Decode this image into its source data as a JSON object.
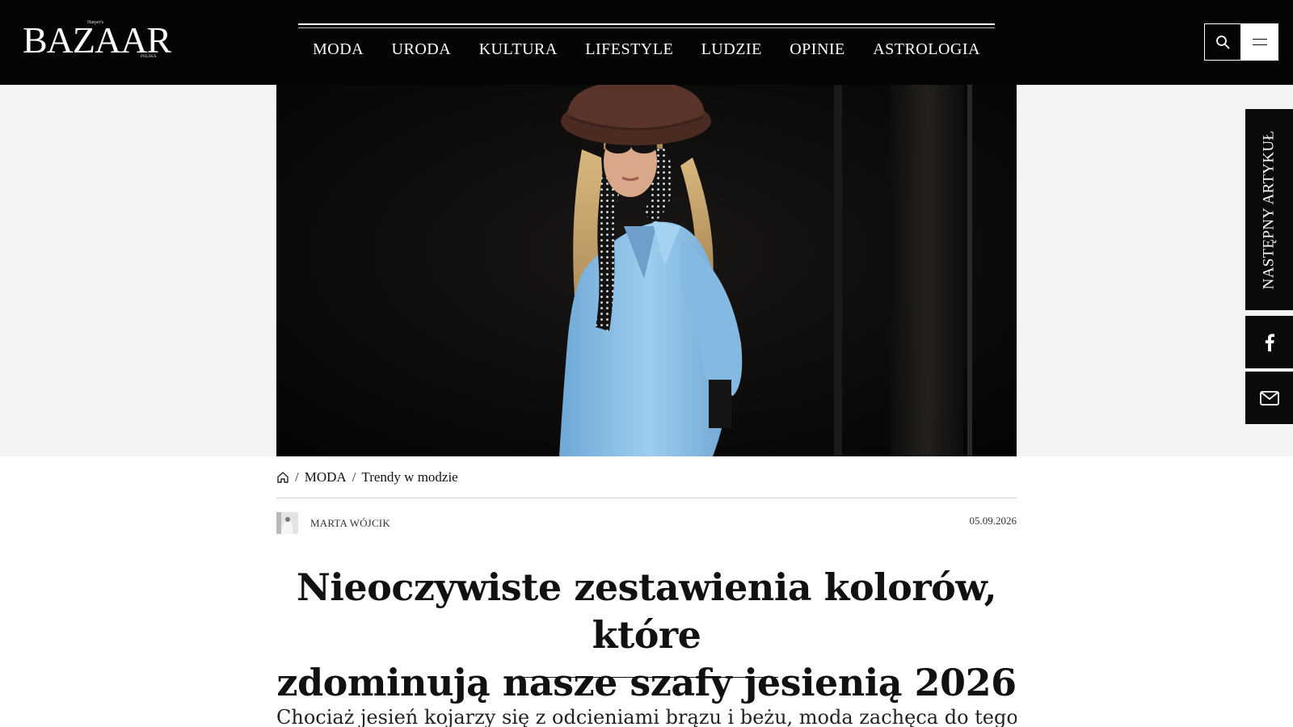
{
  "brand": {
    "logo_text": "BAZAAR",
    "logo_small_top": "Harper's",
    "logo_small_bottom": "POLSKA"
  },
  "nav": {
    "items": [
      {
        "label": "MODA"
      },
      {
        "label": "URODA"
      },
      {
        "label": "KULTURA"
      },
      {
        "label": "LIFESTYLE"
      },
      {
        "label": "LUDZIE"
      },
      {
        "label": "OPINIE"
      },
      {
        "label": "ASTROLOGIA"
      }
    ]
  },
  "header_icons": {
    "search": "search-icon",
    "menu": "hamburger-menu-icon"
  },
  "side_rail": {
    "next_article_label": "NASTĘPNY ARTYKUŁ",
    "facebook_icon": "facebook-icon",
    "mail_icon": "mail-icon"
  },
  "breadcrumb": {
    "home_icon": "home-icon",
    "items": [
      "MODA",
      "Trendy w modzie"
    ],
    "separator": "/"
  },
  "article": {
    "author": "MARTA WÓJCIK",
    "date": "05.09.2026",
    "title_line1": "Nieoczywiste zestawienia kolorów, które",
    "title_line2": "zdominują nasze szafy jesienią 2026",
    "lead": "Chociaż jesień kojarzy się z odcieniami brązu i beżu, moda zachęca do tego,"
  },
  "colors": {
    "header_bg": "#050505",
    "text": "#111111",
    "hero_band": "#f4f4f4",
    "shirt_blue": "#8fc4e8"
  }
}
